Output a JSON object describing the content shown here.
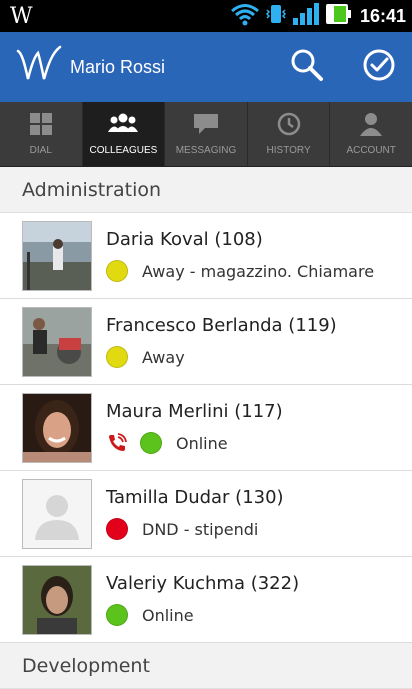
{
  "statusbar": {
    "time": "16:41",
    "logo_letter": "W"
  },
  "appbar": {
    "user_name": "Mario Rossi"
  },
  "tabs": [
    {
      "label": "DIAL",
      "icon": "grid-icon",
      "active": false
    },
    {
      "label": "COLLEAGUES",
      "icon": "people-icon",
      "active": true
    },
    {
      "label": "MESSAGING",
      "icon": "chat-icon",
      "active": false
    },
    {
      "label": "HISTORY",
      "icon": "clock-icon",
      "active": false
    },
    {
      "label": "ACCOUNT",
      "icon": "person-icon",
      "active": false
    }
  ],
  "colors": {
    "away": "#e2da10",
    "online": "#5cc21c",
    "dnd": "#e3001b",
    "call": "#cc1a1a"
  },
  "sections": [
    {
      "title": "Administration",
      "contacts": [
        {
          "name": "Daria Koval (108)",
          "status": "Away - magazzino. Chiamare",
          "state": "away",
          "on_call": false
        },
        {
          "name": "Francesco Berlanda (119)",
          "status": "Away",
          "state": "away",
          "on_call": false
        },
        {
          "name": "Maura Merlini (117)",
          "status": "Online",
          "state": "online",
          "on_call": true
        },
        {
          "name": "Tamilla Dudar (130)",
          "status": "DND - stipendi",
          "state": "dnd",
          "on_call": false
        },
        {
          "name": "Valeriy Kuchma (322)",
          "status": "Online",
          "state": "online",
          "on_call": false
        }
      ]
    },
    {
      "title": "Development",
      "contacts": []
    }
  ]
}
